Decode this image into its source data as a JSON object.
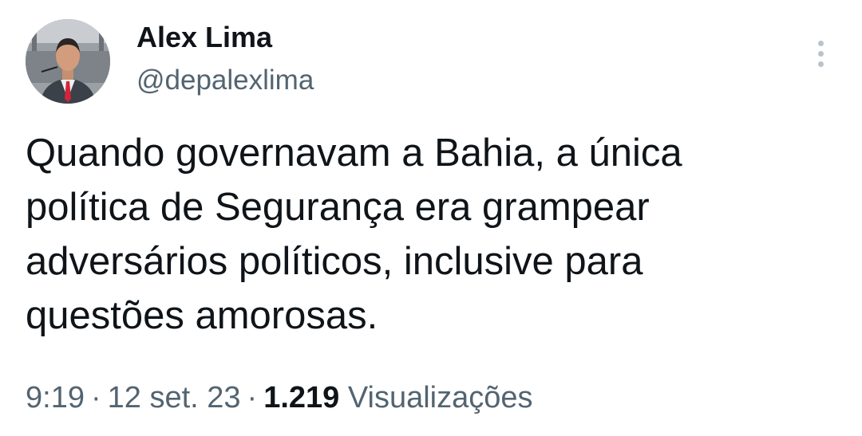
{
  "author": {
    "display_name": "Alex Lima",
    "handle": "@depalexlima",
    "avatar_icon": "profile-photo"
  },
  "more_icon": "more-vertical-icon",
  "tweet": {
    "text": "Quando governavam a Bahia, a única\npolítica de Segurança era grampear\nadversários políticos, inclusive para\nquestões amorosas."
  },
  "meta": {
    "time": "9:19",
    "date": "12 set. 23",
    "separator": "·",
    "views_count": "1.219",
    "views_label": "Visualizações"
  },
  "colors": {
    "text_primary": "#0f1419",
    "text_secondary": "#536471",
    "more_dots": "#b9c3cc"
  }
}
